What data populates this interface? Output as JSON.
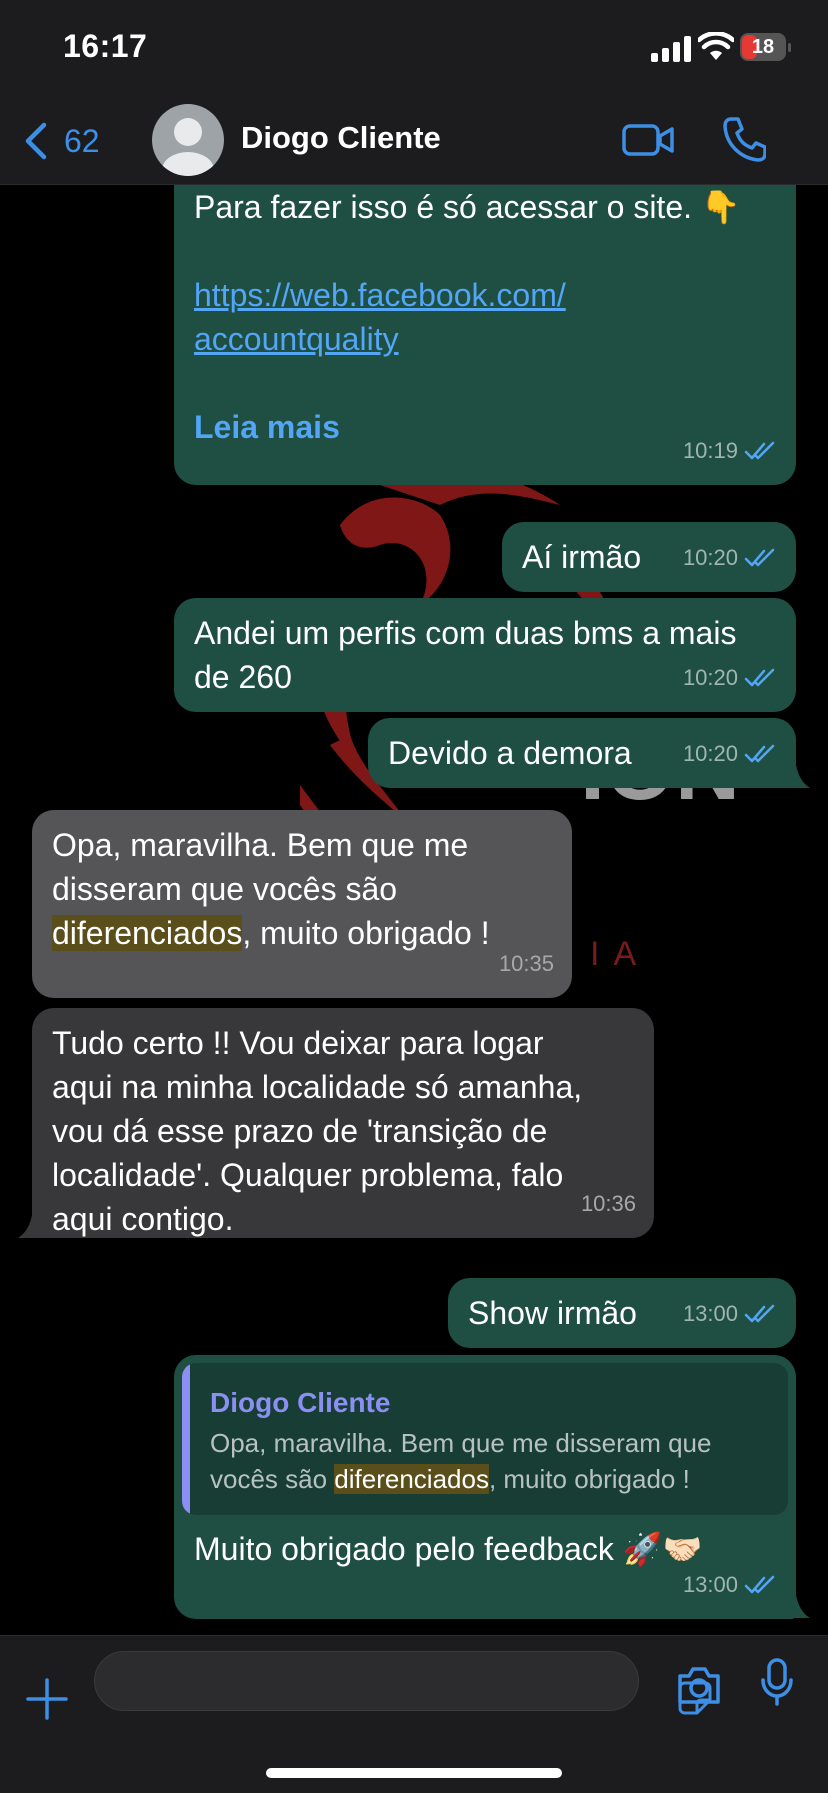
{
  "status_bar": {
    "time": "16:17",
    "battery": "18"
  },
  "header": {
    "back_count": "62",
    "contact_name": "Diogo Cliente"
  },
  "messages": [
    {
      "text": "Para fazer isso é só acessar o site. ",
      "emoji": "👇",
      "link_line1": "https://web.facebook.com/",
      "link_line2": "accountquality",
      "read_more": "Leia mais",
      "time": "10:19"
    },
    {
      "text": "Aí irmão",
      "time": "10:20"
    },
    {
      "line1": "Andei um perfis com duas bms a mais",
      "line2": "de 260",
      "time": "10:20"
    },
    {
      "text": "Devido a demora",
      "time": "10:20"
    },
    {
      "line1": "Opa, maravilha. Bem que me",
      "line2": "disseram que vocês são",
      "highlight": "diferenciados",
      "line3_rest": ", muito obrigado !",
      "time": "10:35"
    },
    {
      "line1": "Tudo certo !!  Vou deixar para logar",
      "line2": "aqui na minha localidade só amanha,",
      "line3": "vou dá esse prazo de 'transição de",
      "line4": "localidade'. Qualquer problema, falo",
      "line5": "aqui contigo.",
      "time": "10:36"
    },
    {
      "text": "Show irmão",
      "time": "13:00"
    },
    {
      "quote_name": "Diogo Cliente",
      "quote_line1": "Opa, maravilha. Bem que me disseram que",
      "quote_line2_pre": "vocês são ",
      "quote_highlight": "diferenciados",
      "quote_line2_post": ", muito obrigado !",
      "text": "Muito obrigado pelo feedback ",
      "emoji": "🚀🤝🏻",
      "time": "13:00"
    }
  ],
  "wallpaper": {
    "text": "ION",
    "subtext": "IA"
  },
  "colors": {
    "accent": "#3d8fe6",
    "outgoing": "#1f4f43",
    "incoming": "#38383a",
    "highlight": "#5a4e1a",
    "quote_name": "#8a8ff2"
  },
  "icons": [
    "back-chevron-icon",
    "video-call-icon",
    "phone-icon",
    "plus-icon",
    "sticker-icon",
    "camera-icon",
    "microphone-icon",
    "double-check-icon"
  ]
}
